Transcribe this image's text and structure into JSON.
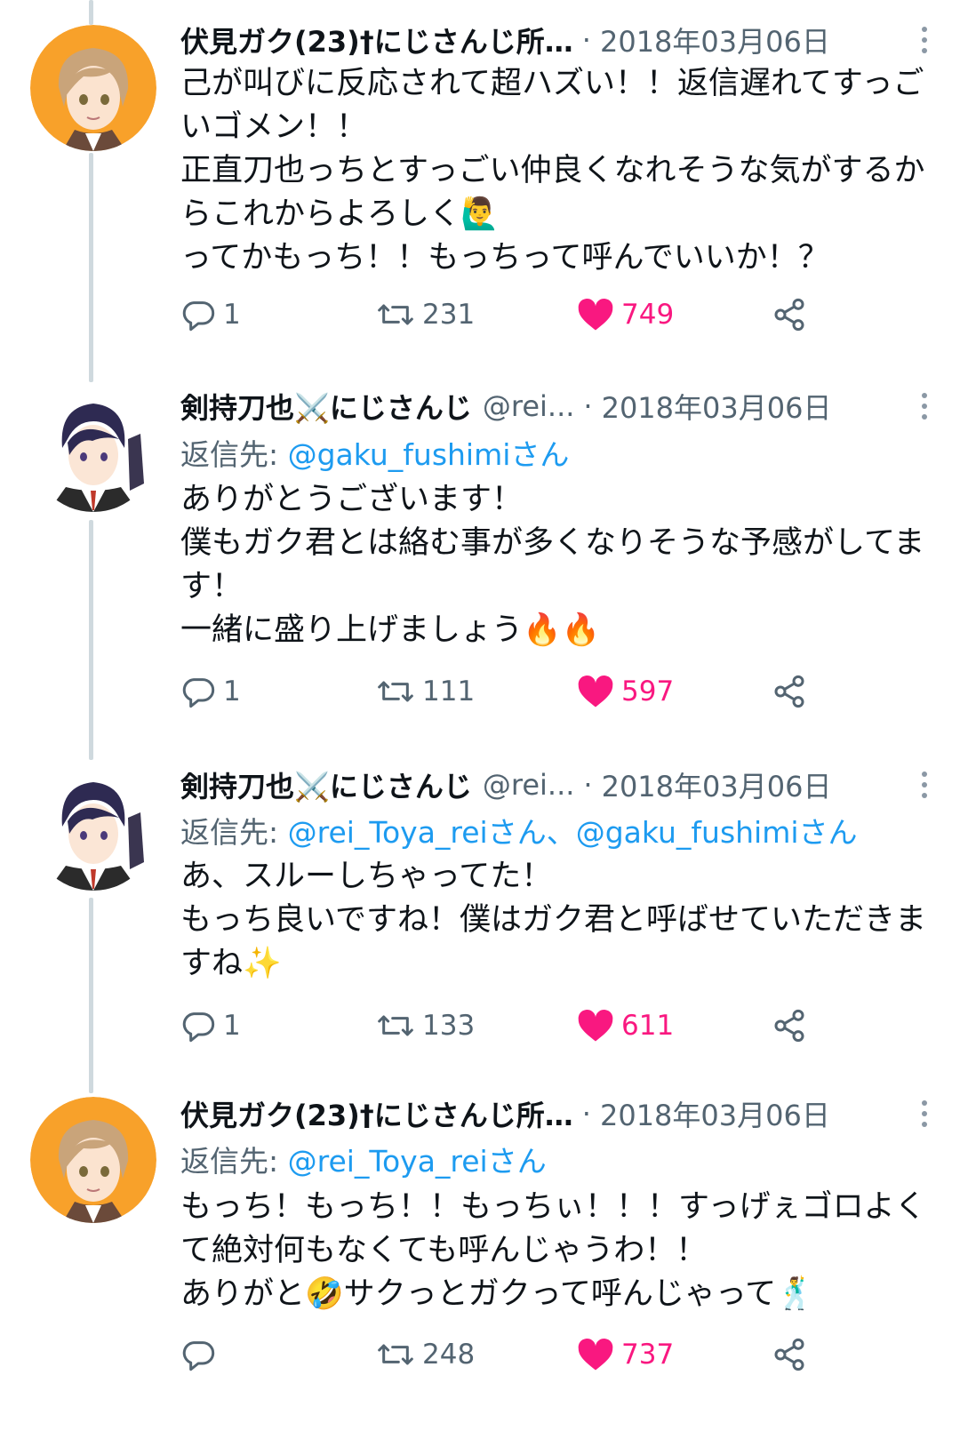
{
  "tweets": [
    {
      "author_name": "伏見ガク(23)†にじさんじ所…",
      "handle": "",
      "date": "2018年03月06日",
      "reply_prefix": "",
      "reply_mentions": "",
      "text": "己が叫びに反応されて超ハズい！！返信遅れてすっごいゴメン！！\n正直刀也っちとすっごい仲良くなれそうな気がするからこれからよろしく🙋‍♂️\nってかもっち！！もっちって呼んでいいか！？",
      "replies": "1",
      "retweets": "231",
      "likes": "749",
      "avatar": "gaku-avatar"
    },
    {
      "author_name": "剣持刀也⚔️にじさんじ",
      "handle": "@rei...",
      "date": "2018年03月06日",
      "reply_prefix": "返信先: ",
      "reply_mentions": "@gaku_fushimiさん",
      "text": "ありがとうございます！\n僕もガク君とは絡む事が多くなりそうな予感がしてます！\n一緒に盛り上げましょう🔥🔥",
      "replies": "1",
      "retweets": "111",
      "likes": "597",
      "avatar": "toya-avatar"
    },
    {
      "author_name": "剣持刀也⚔️にじさんじ",
      "handle": "@rei...",
      "date": "2018年03月06日",
      "reply_prefix": "返信先: ",
      "reply_mentions": "@rei_Toya_reiさん、@gaku_fushimiさん",
      "text": "あ、スルーしちゃってた！\nもっち良いですね！僕はガク君と呼ばせていただきますね✨",
      "replies": "1",
      "retweets": "133",
      "likes": "611",
      "avatar": "toya-avatar"
    },
    {
      "author_name": "伏見ガク(23)†にじさんじ所…",
      "handle": "",
      "date": "2018年03月06日",
      "reply_prefix": "返信先: ",
      "reply_mentions": "@rei_Toya_reiさん",
      "text": "もっち！もっち！！もっちぃ！！！すっげぇゴロよくて絶対何もなくても呼んじゃうわ！！\nありがと🤣サクっとガクって呼んじゃって🕺",
      "replies": "",
      "retweets": "248",
      "likes": "737",
      "avatar": "gaku-avatar"
    }
  ],
  "colors": {
    "text": "#0f1419",
    "secondary": "#536471",
    "link": "#1d9bf0",
    "like": "#f91880",
    "thread_line": "#cfd9de"
  },
  "icons": [
    "reply-icon",
    "retweet-icon",
    "heart-icon",
    "share-icon",
    "more-icon"
  ]
}
